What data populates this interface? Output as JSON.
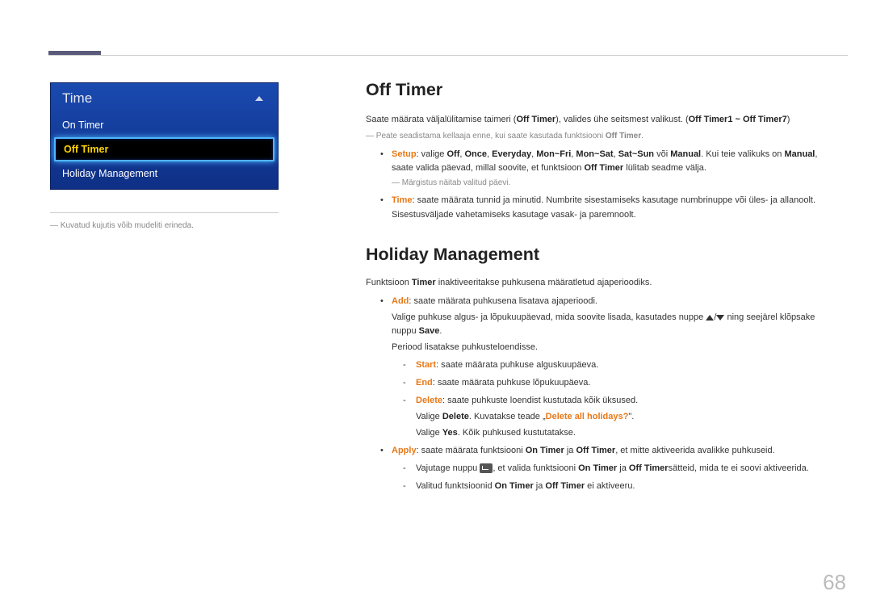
{
  "page_number": "68",
  "left": {
    "menu_title": "Time",
    "items": [
      {
        "label": "On Timer",
        "selected": false
      },
      {
        "label": "Off Timer",
        "selected": true
      },
      {
        "label": "Holiday Management",
        "selected": false
      }
    ],
    "caption_prefix": "―",
    "caption": "Kuvatud kujutis võib mudeliti erineda."
  },
  "section1": {
    "heading": "Off Timer",
    "intro_a": "Saate määrata väljalülitamise taimeri (",
    "intro_bold1": "Off Timer",
    "intro_b": "), valides ühe seitsmest valikust. (",
    "intro_bold2": "Off Timer1 ~ Off Timer7",
    "intro_c": ")",
    "note_prefix": "―",
    "note_a": "Peate seadistama kellaaja enne, kui saate kasutada funktsiooni ",
    "note_bold": "Off Timer",
    "note_b": ".",
    "bullets": [
      {
        "lead": "Setup",
        "a": ": valige ",
        "b1": "Off",
        "s1": ", ",
        "b2": "Once",
        "s2": ", ",
        "b3": "Everyday",
        "s3": ", ",
        "b4": "Mon~Fri",
        "s4": ", ",
        "b5": "Mon~Sat",
        "s5": ", ",
        "b6": "Sat~Sun",
        "s6": " või ",
        "b7": "Manual",
        "c": ". Kui teie valikuks on ",
        "b8": "Manual",
        "d": ", saate valida päevad, millal soovite, et funktsioon ",
        "b9": "Off Timer",
        "e": " lülitab seadme välja.",
        "sub_note_prefix": "―",
        "sub_note": "Märgistus näitab valitud päevi."
      },
      {
        "lead": "Time",
        "text": ": saate määrata tunnid ja minutid. Numbrite sisestamiseks kasutage numbrinuppe või üles- ja allanoolt. Sisestusväljade vahetamiseks kasutage vasak- ja paremnoolt."
      }
    ]
  },
  "section2": {
    "heading": "Holiday Management",
    "intro_a": "Funktsioon ",
    "intro_bold": "Timer",
    "intro_b": " inaktiveeritakse puhkusena määratletud ajaperioodiks.",
    "bullets": [
      {
        "lead": "Add",
        "a": ": saate määrata puhkusena lisatava ajaperioodi.",
        "line2_a": "Valige puhkuse algus- ja lõpukuupäevad, mida soovite lisada, kasutades nuppe ",
        "line2_b": " ning seejärel klõpsake nuppu ",
        "line2_bold": "Save",
        "line2_c": ".",
        "line3": "Periood lisatakse puhkusteloendisse.",
        "subs": [
          {
            "lead": "Start",
            "text": ": saate määrata puhkuse alguskuupäeva."
          },
          {
            "lead": "End",
            "text": ": saate määrata puhkuse lõpukuupäeva."
          },
          {
            "lead": "Delete",
            "a": ": saate puhkuste loendist kustutada kõik üksused.",
            "line2_a": "Valige ",
            "line2_bold": "Delete",
            "line2_b": ". Kuvatakse teade „",
            "line2_msg": "Delete all holidays?",
            "line2_c": "\".",
            "line3_a": "Valige ",
            "line3_bold": "Yes",
            "line3_b": ". Kõik puhkused kustutatakse."
          }
        ]
      },
      {
        "lead": "Apply",
        "a": ": saate määrata funktsiooni ",
        "b1": "On Timer",
        "b": " ja ",
        "b2": "Off Timer",
        "c": ", et mitte aktiveerida avalikke puhkuseid.",
        "subs": [
          {
            "a": "Vajutage nuppu ",
            "b": ", et valida funktsiooni ",
            "b1": "On Timer",
            "c": " ja ",
            "b2": "Off Timer",
            "d": "sätteid, mida te ei soovi aktiveerida."
          },
          {
            "a": "Valitud funktsioonid ",
            "b1": "On Timer",
            "b": " ja ",
            "b2": "Off Timer",
            "c": " ei aktiveeru."
          }
        ]
      }
    ]
  }
}
